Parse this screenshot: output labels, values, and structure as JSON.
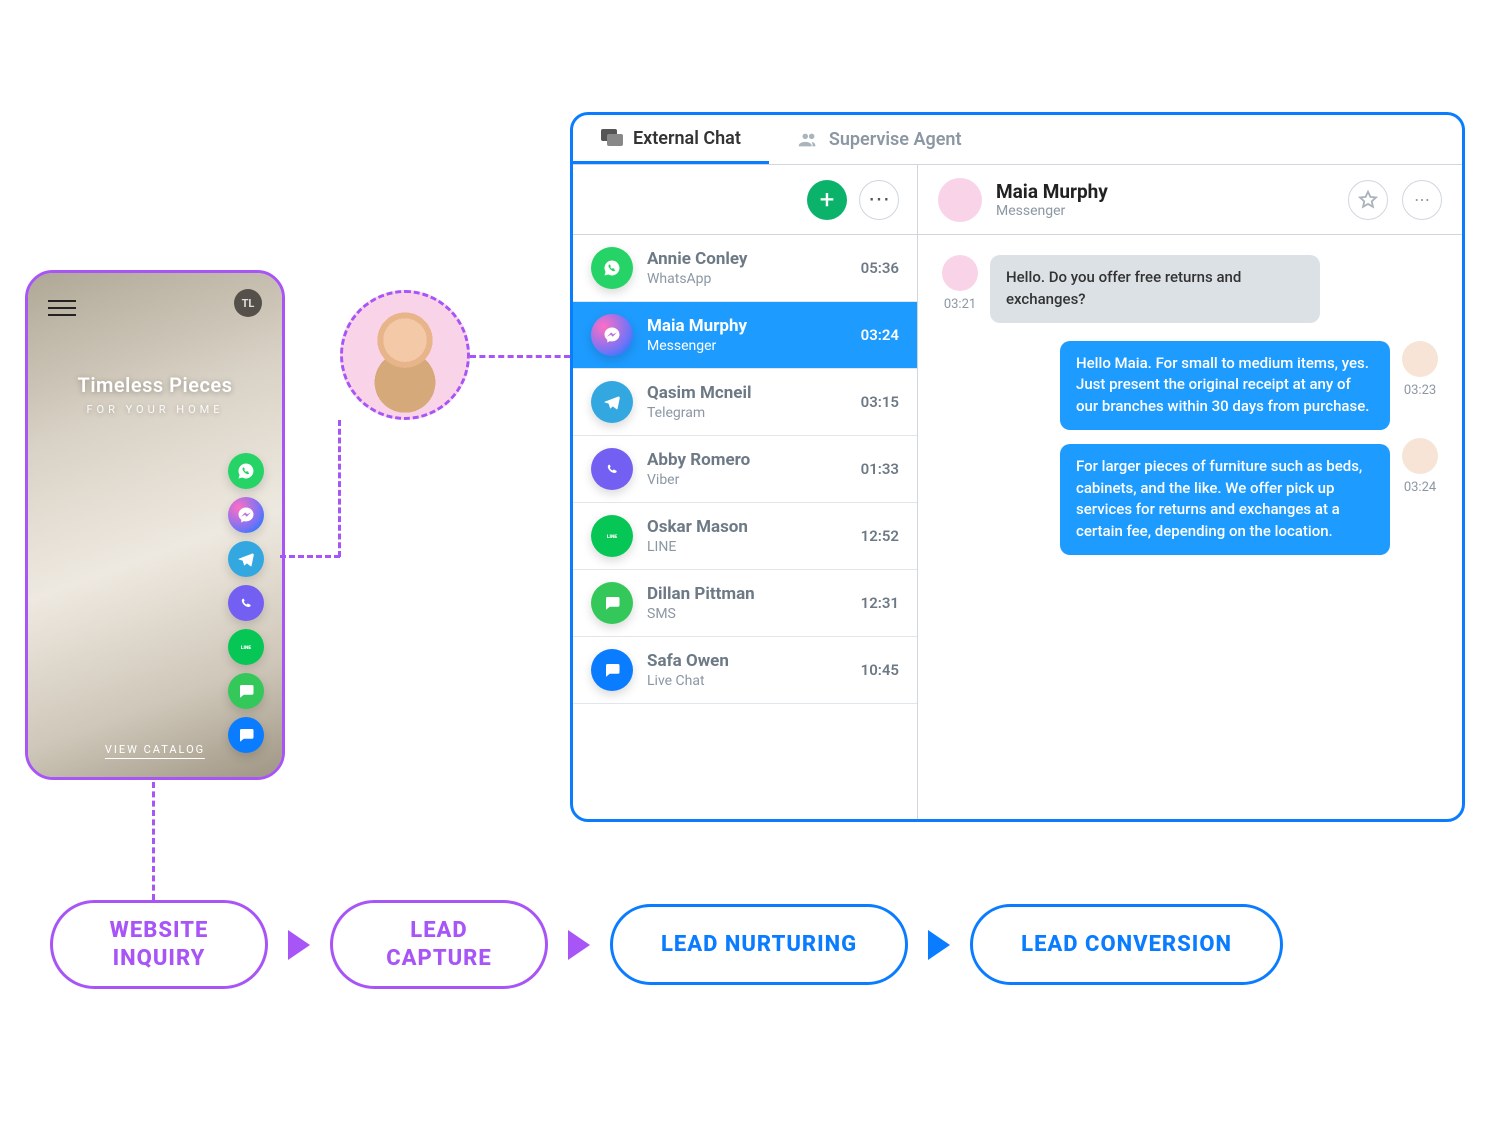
{
  "phone": {
    "headline": "Timeless Pieces",
    "subhead": "FOR YOUR HOME",
    "cta": "VIEW CATALOG",
    "logo": "TL"
  },
  "tabs": {
    "external_chat": "External Chat",
    "supervise_agent": "Supervise Agent"
  },
  "conversations": [
    {
      "name": "Annie Conley",
      "source": "WhatsApp",
      "time": "05:36",
      "channel": "whatsapp"
    },
    {
      "name": "Maia Murphy",
      "source": "Messenger",
      "time": "03:24",
      "channel": "messenger",
      "active": true
    },
    {
      "name": "Qasim Mcneil",
      "source": "Telegram",
      "time": "03:15",
      "channel": "telegram"
    },
    {
      "name": "Abby Romero",
      "source": "Viber",
      "time": "01:33",
      "channel": "viber"
    },
    {
      "name": "Oskar Mason",
      "source": "LINE",
      "time": "12:52",
      "channel": "line"
    },
    {
      "name": "Dillan Pittman",
      "source": "SMS",
      "time": "12:31",
      "channel": "sms"
    },
    {
      "name": "Safa Owen",
      "source": "Live Chat",
      "time": "10:45",
      "channel": "livechat"
    }
  ],
  "chat": {
    "header_name": "Maia Murphy",
    "header_source": "Messenger",
    "messages": {
      "in1_time": "03:21",
      "in1_text": "Hello. Do you offer free returns and exchanges?",
      "out1_time": "03:23",
      "out1_text": "Hello Maia. For small to medium items, yes. Just present the original receipt at any of our branches within 30 days from purchase.",
      "out2_time": "03:24",
      "out2_text": "For larger pieces of furniture such as beds, cabinets, and the like. We offer pick up services for returns and exchanges at a certain fee, depending on the location."
    }
  },
  "funnel": {
    "step1": "WEBSITE INQUIRY",
    "step2": "LEAD CAPTURE",
    "step3": "LEAD NURTURING",
    "step4": "LEAD CONVERSION"
  }
}
